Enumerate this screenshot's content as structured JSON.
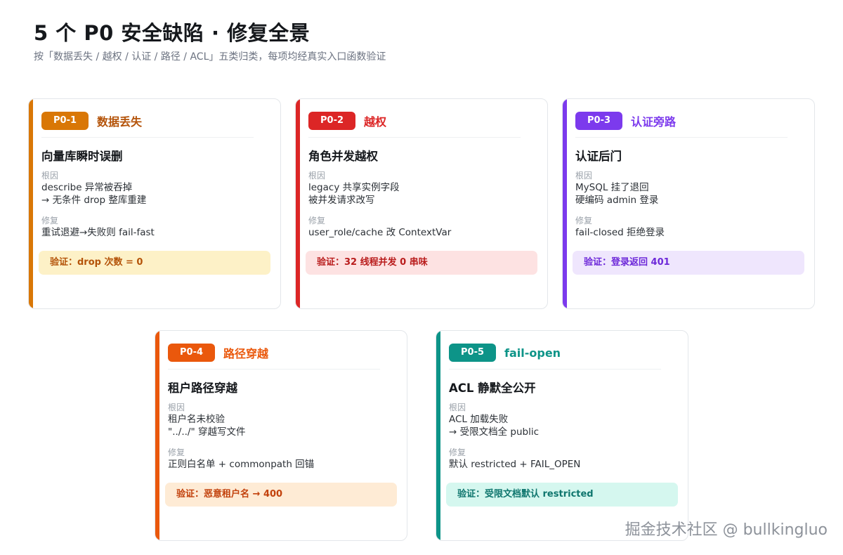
{
  "header": {
    "title": "5 个 P0 安全缺陷 · 修复全景",
    "subtitle": "按「数据丢失 / 越权 / 认证 / 路径 / ACL」五类归类，每项均经真实入口函数验证"
  },
  "labels": {
    "root_cause": "根因",
    "fix": "修复"
  },
  "cards": [
    {
      "badge": "P0-1",
      "category": "数据丢失",
      "name": "向量库瞬时误删",
      "root_lines": [
        "describe 异常被吞掉",
        "→ 无条件 drop 整库重建"
      ],
      "fix": "重试退避→失败则 fail-fast",
      "verify": "验证：drop 次数 = 0",
      "color": "#d97706"
    },
    {
      "badge": "P0-2",
      "category": "越权",
      "name": "角色并发越权",
      "root_lines": [
        "legacy 共享实例字段",
        "被并发请求改写"
      ],
      "fix": "user_role/cache 改 ContextVar",
      "verify": "验证：32 线程并发 0 串味",
      "color": "#dc2626"
    },
    {
      "badge": "P0-3",
      "category": "认证旁路",
      "name": "认证后门",
      "root_lines": [
        "MySQL 挂了退回",
        "硬编码 admin 登录"
      ],
      "fix": "fail-closed 拒绝登录",
      "verify": "验证：登录返回 401",
      "color": "#7c3aed"
    },
    {
      "badge": "P0-4",
      "category": "路径穿越",
      "name": "租户路径穿越",
      "root_lines": [
        "租户名未校验",
        "\"../../\" 穿越写文件"
      ],
      "fix": "正则白名单 + commonpath 回锚",
      "verify": "验证：恶意租户名 → 400",
      "color": "#ea580c"
    },
    {
      "badge": "P0-5",
      "category": "fail-open",
      "name": "ACL 静默全公开",
      "root_lines": [
        "ACL 加载失败",
        "→ 受限文档全 public"
      ],
      "fix": "默认 restricted + FAIL_OPEN",
      "verify": "验证：受限文档默认 restricted",
      "color": "#0d9488"
    }
  ],
  "watermark": "掘金技术社区 @ bullkingluo"
}
